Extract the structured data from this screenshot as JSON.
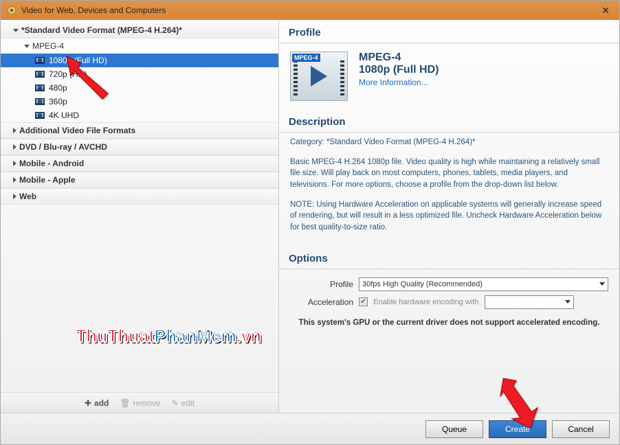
{
  "window": {
    "title": "Video for Web, Devices and Computers"
  },
  "tree": {
    "cat0": {
      "label": "*Standard Video Format (MPEG-4 H.264)*"
    },
    "sub0": {
      "label": "MPEG-4"
    },
    "leaves": {
      "l0": "1080p (Full HD)",
      "l1": "720p (HD)",
      "l2": "480p",
      "l3": "360p",
      "l4": "4K UHD"
    },
    "cat1": "Additional Video File Formats",
    "cat2": "DVD / Blu-ray / AVCHD",
    "cat3": "Mobile - Android",
    "cat4": "Mobile - Apple",
    "cat5": "Web"
  },
  "toolbar": {
    "add": "add",
    "remove": "remove",
    "edit": "edit"
  },
  "right": {
    "profile_h": "Profile",
    "profile_badge": "MPEG-4",
    "profile_title": "MPEG-4",
    "profile_sub": "1080p (Full HD)",
    "more_info": "More Information...",
    "desc_h": "Description",
    "desc_category_label": "Category: *Standard Video Format (MPEG-4 H.264)*",
    "desc_p1": "Basic MPEG-4 H.264 1080p file. Video quality is high while maintaining a relatively small file size. Will play back on most computers, phones, tablets, media players, and televisions. For more options, choose a profile from the drop-down list below.",
    "desc_p2": "NOTE: Using Hardware Acceleration on applicable systems will generally increase speed of rendering, but will result in a less optimized file. Uncheck Hardware Acceleration below for best quality-to-size ratio.",
    "options_h": "Options",
    "opt_profile_label": "Profile",
    "opt_profile_value": "30fps High Quality (Recommended)",
    "opt_accel_label": "Acceleration",
    "opt_accel_chk": "Enable hardware encoding with",
    "gpu_warn": "This system's GPU or the current driver does not support accelerated encoding."
  },
  "footer": {
    "queue": "Queue",
    "create": "Create",
    "cancel": "Cancel"
  },
  "watermark": {
    "a": "ThuThuat",
    "b": "PhanMem",
    "c": ".vn"
  }
}
